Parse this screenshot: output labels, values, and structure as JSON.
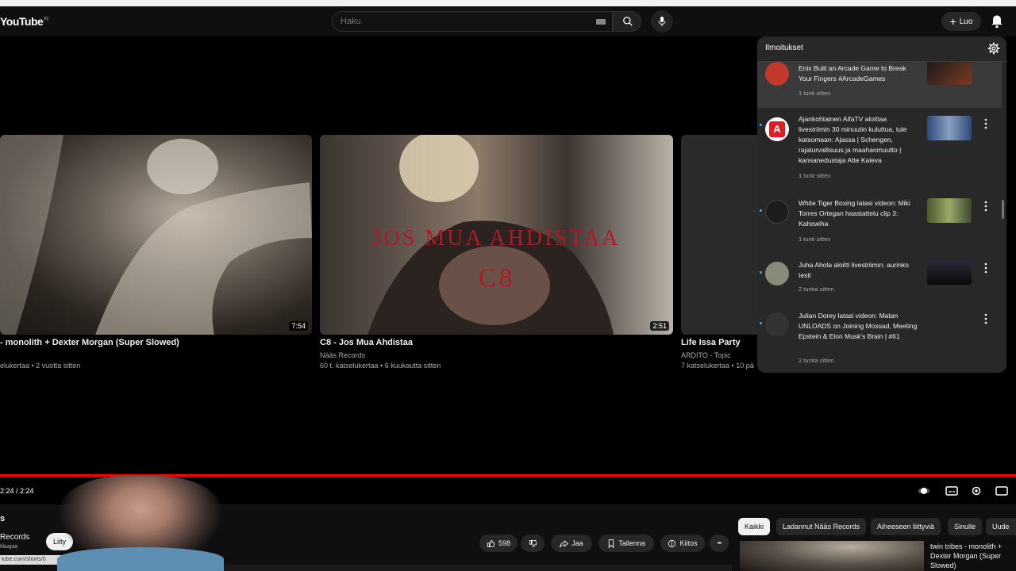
{
  "header": {
    "logo": "YouTube",
    "logo_region": "FI",
    "search_placeholder": "Haku",
    "create_label": "Luo"
  },
  "endscreen": [
    {
      "title": "- monolith + Dexter Morgan (Super Slowed)",
      "channel": "",
      "meta": "elukertaa • 2 vuotta sitten",
      "duration": "7:54"
    },
    {
      "title": "C8 - Jos Mua Ahdistaa",
      "channel": "Nääs Records",
      "meta": "60 t. katselukertaa • 6 kuukautta sitten",
      "duration": "2:51",
      "overlay_title": "JOS MUA AHDISTAA",
      "overlay_sub": "C8"
    },
    {
      "title": "Life Issa Party",
      "channel": "ARDITO - Topic",
      "meta": "7 katselukertaa • 10 pä"
    }
  ],
  "notifications": {
    "title": "Ilmoitukset",
    "items": [
      {
        "text": "Enix Built an Arcade Game to Break Your Fingers #ArcadeGames",
        "time": "1 tunti sitten",
        "avatar_color": "#c0392b",
        "thumb_color": "#4a3020"
      },
      {
        "text": "Ajankohtainen AlfaTV aloittaa livestriimin 30 minuutin kuluttua, tule katsomaan: Ajassa | Schengen, rajaturvallisuus ja maahanmuutto | kansanedustaja Atte Kaleva",
        "time": "1 tunti sitten",
        "avatar_label": "A",
        "avatar_color": "#e31b23",
        "thumb_color": "#2c4a7a"
      },
      {
        "text": "White Tiger Boxing latasi videon: Miki Torres Ortegan haastattelu clip 3: Kahowiha",
        "time": "1 tunti sitten",
        "avatar_color": "#222",
        "thumb_color": "#5a6a3a"
      },
      {
        "text": "Juha Ahola aloitti livestriimin: aurinko testi",
        "time": "2 tuntia sitten",
        "avatar_color": "#8a8a7a",
        "thumb_color": "#1a1a2a"
      },
      {
        "text": "Julian Dorey latasi videon: Matan UNLOADS on Joining Mossad, Meeting Epstein & Elon Musk's Brain | #61",
        "time": "2 tuntia sitten",
        "avatar_color": "#333",
        "thumb_color": "#333"
      }
    ]
  },
  "player": {
    "time": "2:24 / 2:24",
    "progress": 1.0
  },
  "below": {
    "channel_initial": "s",
    "channel_name": "Records",
    "subs_label": "tilaajaa",
    "join_label": "Liity",
    "url_hint": "tube.com/shorts/0",
    "likes": "598",
    "share_label": "Jaa",
    "save_label": "Tallenna",
    "thanks_label": "Kiitos",
    "more_label": "•••"
  },
  "chips": [
    "Kaikki",
    "Ladannut Nääs Records",
    "Aiheeseen liittyviä",
    "Sinulle",
    "Uude"
  ],
  "recommendation": {
    "title": "twin tribes - monolith + Dexter Morgan (Super Slowed)"
  }
}
